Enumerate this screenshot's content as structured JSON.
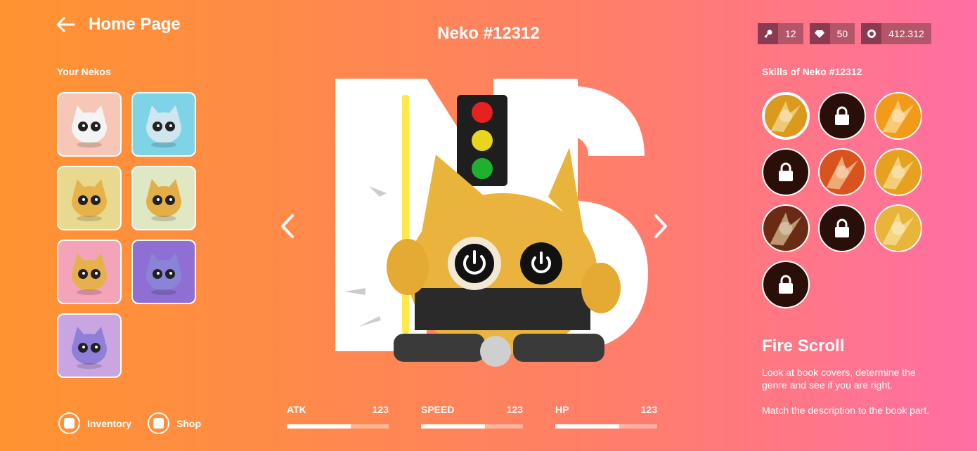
{
  "header": {
    "back_label": "Home Page",
    "title": "Neko #12312"
  },
  "currencies": [
    {
      "icon": "key-icon",
      "value": "12"
    },
    {
      "icon": "diamond-icon",
      "value": "50"
    },
    {
      "icon": "coin-icon",
      "value": "412.312"
    }
  ],
  "left": {
    "heading": "Your Nekos",
    "nekos": [
      {
        "name": "neko-white",
        "bg": "#f6c6b6",
        "body": "#f4f4f4"
      },
      {
        "name": "neko-blue",
        "bg": "#7fd3e6",
        "body": "#cfe6ef"
      },
      {
        "name": "neko-gold-red",
        "bg": "#e9d98f",
        "body": "#e8b24a"
      },
      {
        "name": "neko-gold-green",
        "bg": "#dfe7c3",
        "body": "#e3ae45"
      },
      {
        "name": "neko-gold-pink",
        "bg": "#f3a4b9",
        "body": "#e6b14d"
      },
      {
        "name": "neko-purple-gear",
        "bg": "#8f6fd4",
        "body": "#8a84d8"
      },
      {
        "name": "neko-purple",
        "bg": "#c9a6e2",
        "body": "#8f7fd8"
      }
    ],
    "nav": [
      {
        "label": "Inventory",
        "icon": "inventory-icon"
      },
      {
        "label": "Shop",
        "icon": "shop-icon"
      }
    ]
  },
  "stats": [
    {
      "label": "ATK",
      "value": "123",
      "fill": 0.63
    },
    {
      "label": "SPEED",
      "value": "123",
      "fill": 0.63
    },
    {
      "label": "HP",
      "value": "123",
      "fill": 0.63
    }
  ],
  "right": {
    "heading": "Skills of Neko #12312",
    "skills": [
      {
        "name": "skill-golden-owl",
        "locked": false,
        "selected": true,
        "color": "#d99a1e"
      },
      {
        "name": "skill-locked-1",
        "locked": true
      },
      {
        "name": "skill-fire-slash",
        "locked": false,
        "color": "#f29a1a"
      },
      {
        "name": "skill-locked-2",
        "locked": true
      },
      {
        "name": "skill-fire-scroll",
        "locked": false,
        "color": "#d9531e"
      },
      {
        "name": "skill-lightning",
        "locked": false,
        "color": "#e6a21f"
      },
      {
        "name": "skill-dark-beast",
        "locked": false,
        "color": "#6b2a14"
      },
      {
        "name": "skill-locked-3",
        "locked": true
      },
      {
        "name": "skill-explosion",
        "locked": false,
        "color": "#e8b43a"
      },
      {
        "name": "skill-locked-4",
        "locked": true
      }
    ],
    "selected_name": "Fire Scroll",
    "selected_desc": [
      "Look at book covers, determine the genre and see if you are right.",
      "Match the description to the book part."
    ]
  }
}
